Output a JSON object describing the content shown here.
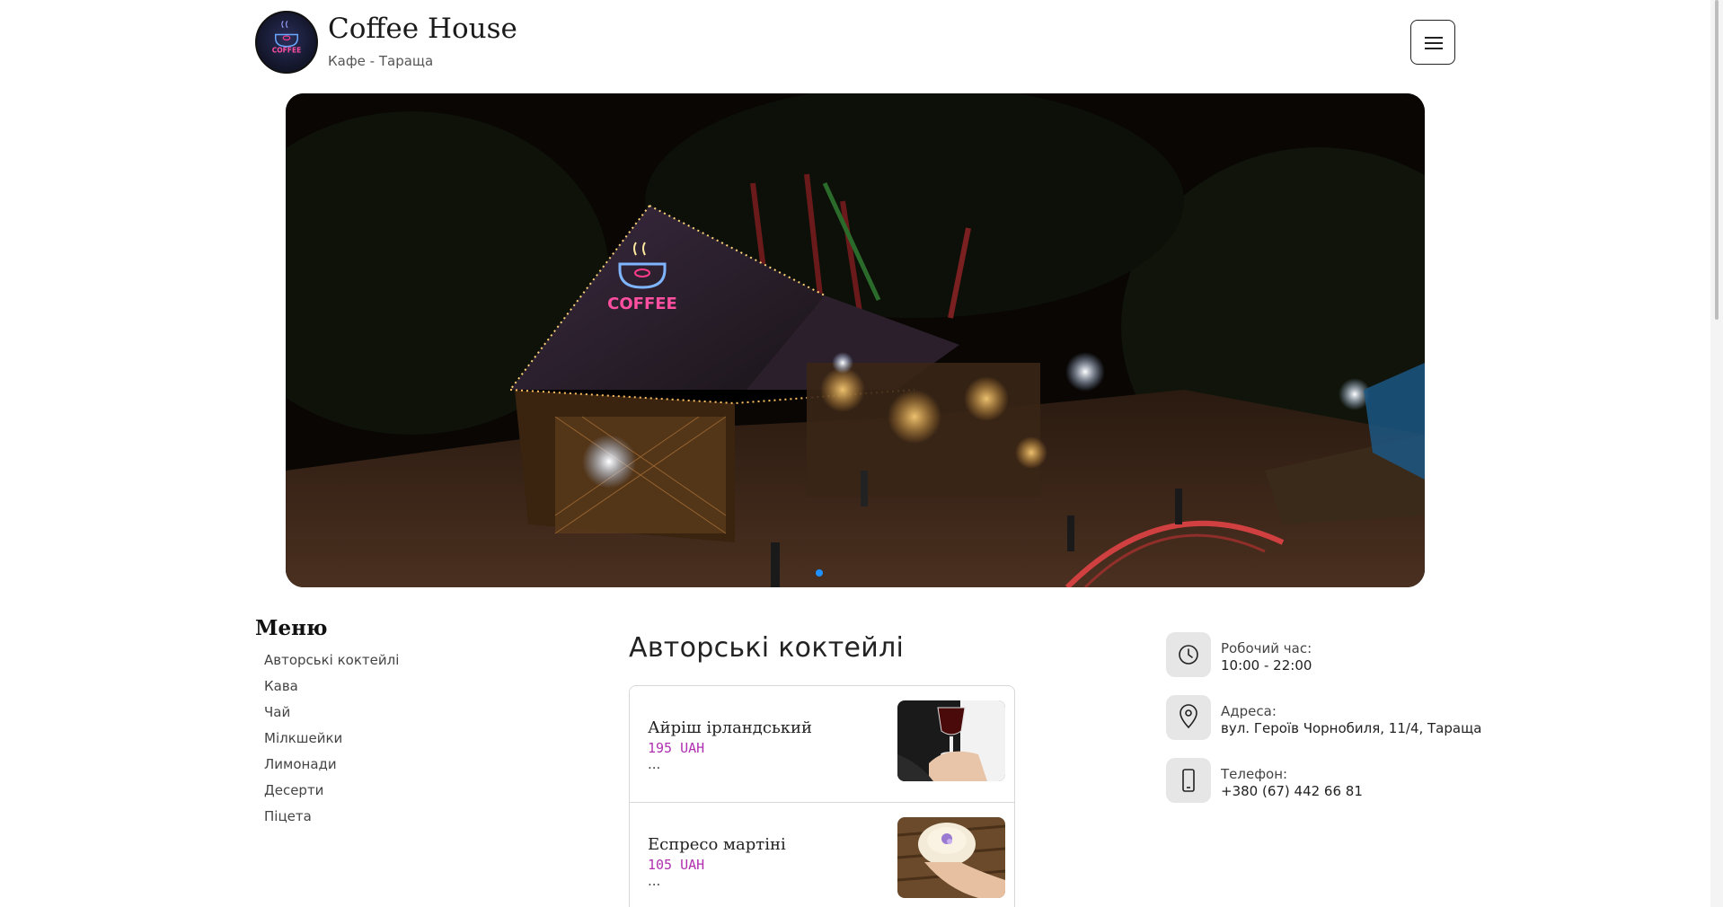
{
  "header": {
    "logo_text": "COFFEE",
    "title": "Coffee House",
    "subtitle": "Кафе - Тараща"
  },
  "hero": {
    "sign_text": "COFFEE",
    "active_slide": 1,
    "slides_count": 1
  },
  "sidebar": {
    "title": "Меню",
    "items": [
      {
        "label": "Авторські коктейлі"
      },
      {
        "label": "Кава"
      },
      {
        "label": "Чай"
      },
      {
        "label": "Мілкшейки"
      },
      {
        "label": "Лимонади"
      },
      {
        "label": "Десерти"
      },
      {
        "label": "Піцета"
      }
    ]
  },
  "main": {
    "section_title": "Авторські коктейлі",
    "items": [
      {
        "name": "Айріш ірландський",
        "price": "195 UAH",
        "desc": "..."
      },
      {
        "name": "Еспресо мартіні",
        "price": "105 UAH",
        "desc": "..."
      }
    ]
  },
  "info": {
    "hours": {
      "label": "Робочий час:",
      "value": "10:00 - 22:00",
      "icon": "clock-icon"
    },
    "address": {
      "label": "Адреса:",
      "value": "вул. Героїв Чорнобиля, 11/4, Тараща",
      "icon": "location-pin-icon"
    },
    "phone": {
      "label": "Телефон:",
      "value": "+380 (67) 442 66 81",
      "icon": "phone-icon"
    }
  },
  "colors": {
    "price": "#b030b0",
    "slider_dot": "#1e90ff",
    "icon_bg": "#e6e6e6"
  }
}
